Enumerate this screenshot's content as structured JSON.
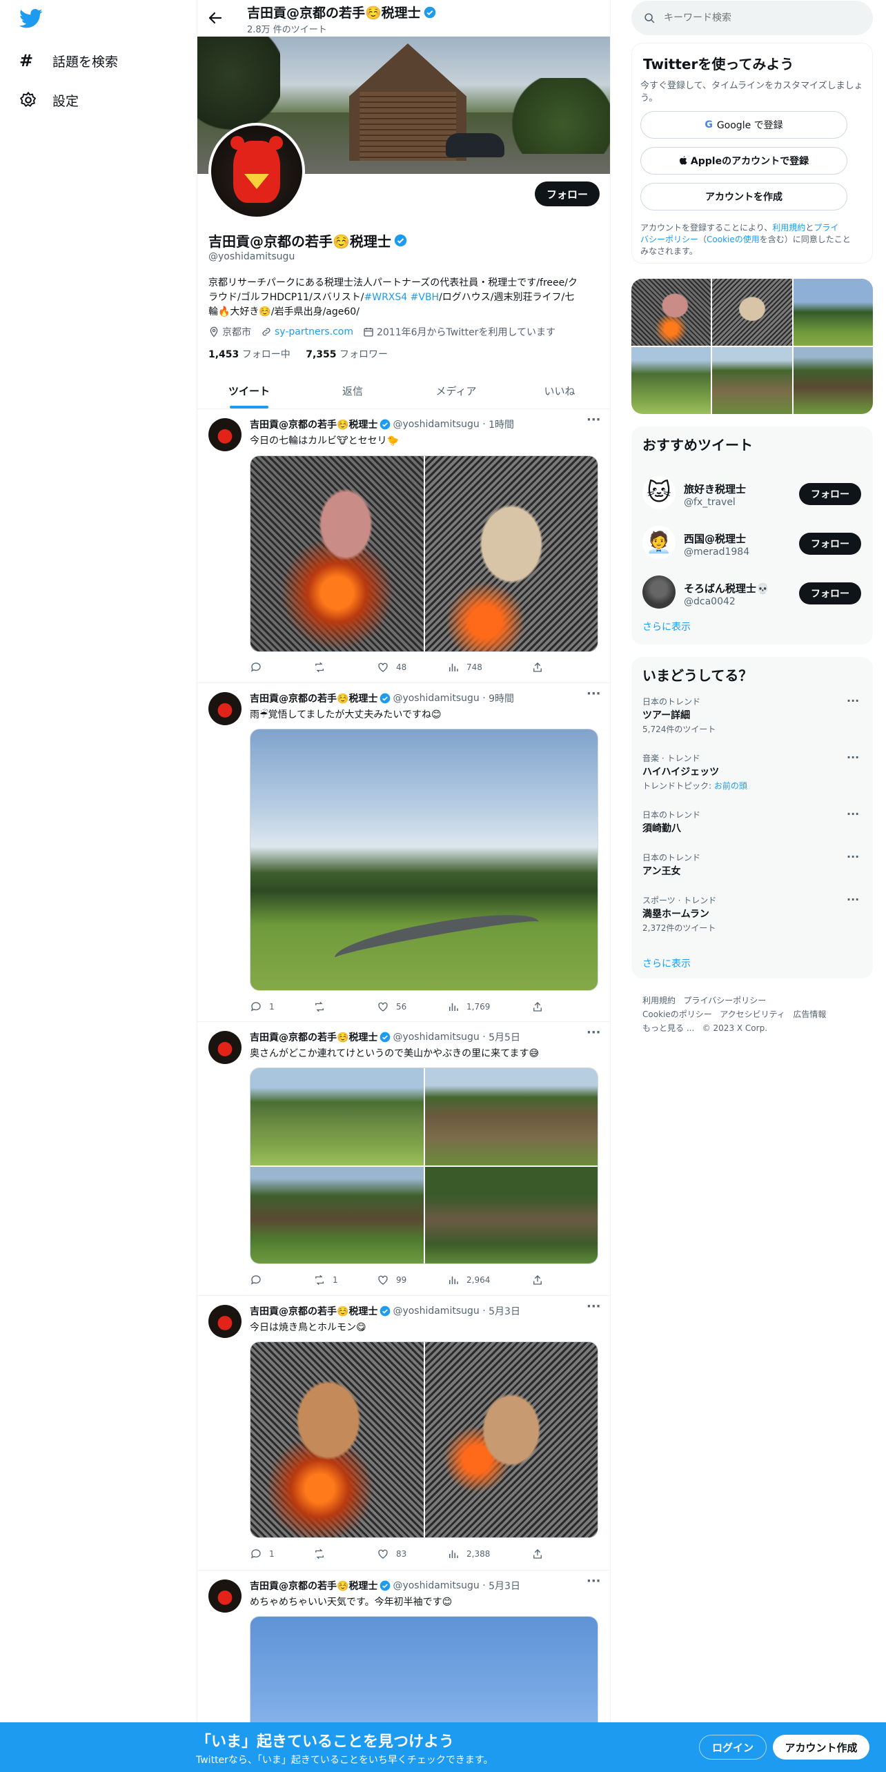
{
  "nav": {
    "explore": "話題を検索",
    "settings": "設定"
  },
  "header": {
    "name": "吉田貢@京都の若手☺️税理士",
    "tweet_count": "2.8万 件のツイート"
  },
  "profile": {
    "name": "吉田貢@京都の若手☺️税理士",
    "handle": "@yoshidamitsugu",
    "follow": "フォロー",
    "bio_1": "京都リサーチパークにある税理士法人パートナーズの代表社員・税理士です/freee/ク",
    "bio_2a": "ラウド/ゴルフHDCP11/スバリスト/",
    "bio_2b": "#WRXS4",
    "bio_2c": "#VBH",
    "bio_2d": "/ログハウス/週末別荘ライフ/七",
    "bio_3": "輪🔥大好き☺️/岩手県出身/age60/",
    "location": "京都市",
    "link": "sy-partners.com",
    "joined": "2011年6月からTwitterを利用しています",
    "following_count": "1,453",
    "following_label": "フォロー中",
    "followers_count": "7,355",
    "followers_label": "フォロワー"
  },
  "tabs": [
    "ツイート",
    "返信",
    "メディア",
    "いいね"
  ],
  "tweets": [
    {
      "name": "吉田貢@京都の若手☺️税理士",
      "handle": "@yoshidamitsugu",
      "time": "1時間",
      "text": "今日の七輪はカルビ🐮とセセリ🐤",
      "reply": "",
      "retweet": "",
      "like": "48",
      "views": "748"
    },
    {
      "name": "吉田貢@京都の若手☺️税理士",
      "handle": "@yoshidamitsugu",
      "time": "9時間",
      "text": "雨☔覚悟してましたが大丈夫みたいですね😊",
      "reply": "1",
      "retweet": "",
      "like": "56",
      "views": "1,769"
    },
    {
      "name": "吉田貢@京都の若手☺️税理士",
      "handle": "@yoshidamitsugu",
      "time": "5月5日",
      "text": "奥さんがどこか連れてけというので美山かやぶきの里に来てます😅",
      "reply": "",
      "retweet": "1",
      "like": "99",
      "views": "2,964"
    },
    {
      "name": "吉田貢@京都の若手☺️税理士",
      "handle": "@yoshidamitsugu",
      "time": "5月3日",
      "text": "今日は焼き鳥とホルモン😋",
      "reply": "1",
      "retweet": "",
      "like": "83",
      "views": "2,388"
    },
    {
      "name": "吉田貢@京都の若手☺️税理士",
      "handle": "@yoshidamitsugu",
      "time": "5月3日",
      "text": "めちゃめちゃいい天気です。今年初半袖です😊"
    }
  ],
  "search": {
    "placeholder": "キーワード検索"
  },
  "signup": {
    "title": "Twitterを使ってみよう",
    "sub_1": "今すぐ登録して、タイムラインをカスタマイズしましょ",
    "sub_2": "う。",
    "google": "Google で登録",
    "apple": "Appleのアカウントで登録",
    "create": "アカウントを作成",
    "terms_1a": "アカウントを登録することにより、",
    "terms_1b": "利用規約",
    "terms_1c": "と",
    "terms_1d": "プライ",
    "terms_2a": "バシーポリシー",
    "terms_2b": "（",
    "terms_2c": "Cookieの使用",
    "terms_2d": "を含む）に同意したこと",
    "terms_3": "みなされます。"
  },
  "recommended": {
    "title": "おすすめツイート",
    "more": "さらに表示",
    "follow": "フォロー",
    "users": [
      {
        "name": "旅好き税理士",
        "handle": "@fx_travel"
      },
      {
        "name": "西国@税理士",
        "handle": "@merad1984"
      },
      {
        "name": "そろばん税理士💀",
        "handle": "@dca0042"
      }
    ]
  },
  "trends": {
    "title": "いまどうしてる？",
    "more": "さらに表示",
    "items": [
      {
        "category": "日本のトレンド",
        "name": "ツアー詳細",
        "count": "5,724件のツイート"
      },
      {
        "category": "音楽 · トレンド",
        "name": "ハイハイジェッツ",
        "count_label": "トレンドトピック:",
        "count_link": "お前の頭"
      },
      {
        "category": "日本のトレンド",
        "name": "須崎勤八"
      },
      {
        "category": "日本のトレンド",
        "name": "アン王女"
      },
      {
        "category": "スポーツ · トレンド",
        "name": "満塁ホームラン",
        "count": "2,372件のツイート"
      }
    ]
  },
  "footer": {
    "l1a": "利用規約",
    "l1b": "プライバシーポリシー",
    "l2a": "Cookieのポリシー",
    "l2b": "アクセシビリティ",
    "l2c": "広告情報",
    "l3a": "もっと見る ...",
    "l3b": "© 2023 X Corp."
  },
  "bottom_bar": {
    "title": "「いま」起きていることを見つけよう",
    "sub": "Twitterなら、「いま」起きていることをいち早くチェックできます。",
    "login": "ログイン",
    "signup": "アカウント作成"
  },
  "colors": {
    "brand": "#1d9bf0",
    "text": "#0f1419",
    "secondary": "#536471",
    "bar": "#1d9bf0"
  }
}
